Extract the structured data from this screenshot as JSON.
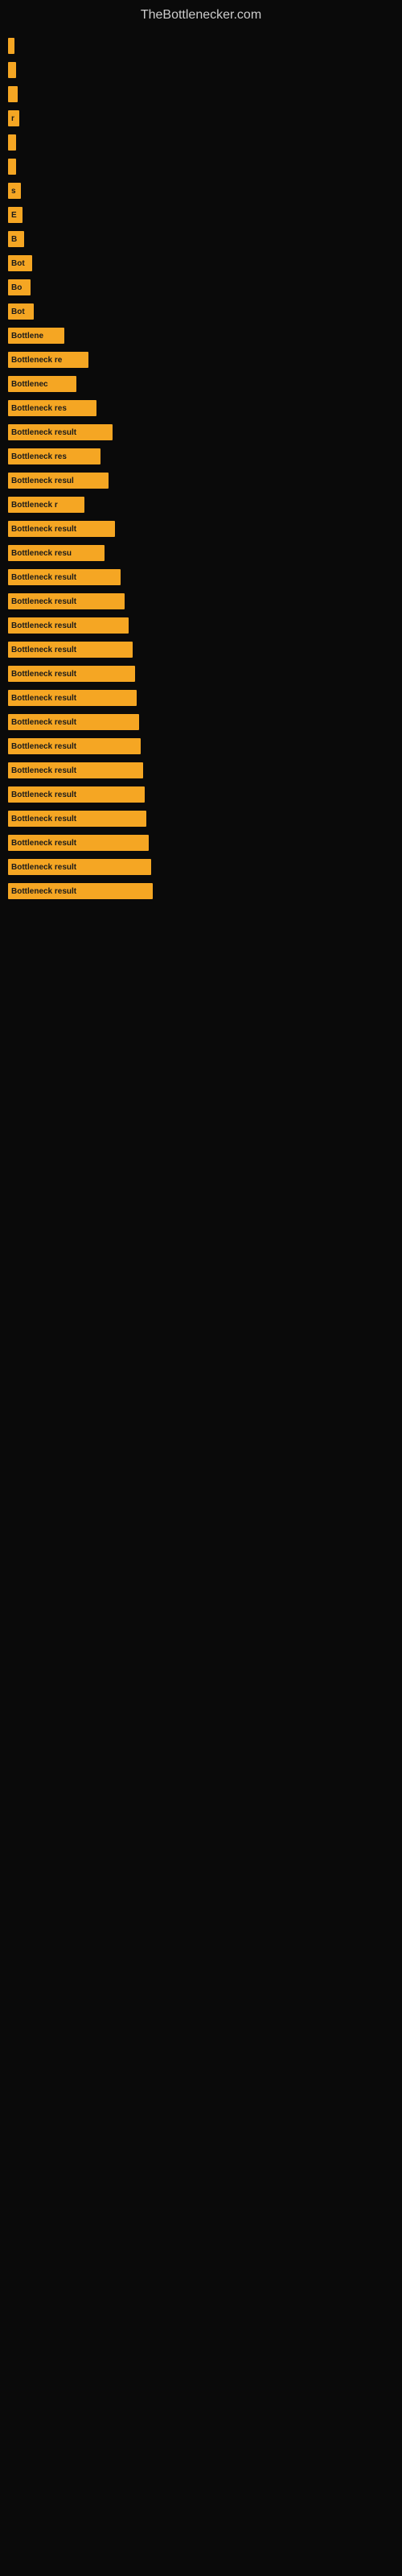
{
  "site": {
    "title": "TheBottlenecker.com"
  },
  "bars": [
    {
      "label": "",
      "width": 8
    },
    {
      "label": "",
      "width": 10
    },
    {
      "label": "",
      "width": 12
    },
    {
      "label": "r",
      "width": 14
    },
    {
      "label": "",
      "width": 10
    },
    {
      "label": "",
      "width": 10
    },
    {
      "label": "s",
      "width": 16
    },
    {
      "label": "E",
      "width": 18
    },
    {
      "label": "B",
      "width": 20
    },
    {
      "label": "Bot",
      "width": 30
    },
    {
      "label": "Bo",
      "width": 28
    },
    {
      "label": "Bot",
      "width": 32
    },
    {
      "label": "Bottlene",
      "width": 70
    },
    {
      "label": "Bottleneck re",
      "width": 100
    },
    {
      "label": "Bottlenec",
      "width": 85
    },
    {
      "label": "Bottleneck res",
      "width": 110
    },
    {
      "label": "Bottleneck result",
      "width": 130
    },
    {
      "label": "Bottleneck res",
      "width": 115
    },
    {
      "label": "Bottleneck resul",
      "width": 125
    },
    {
      "label": "Bottleneck r",
      "width": 95
    },
    {
      "label": "Bottleneck result",
      "width": 133
    },
    {
      "label": "Bottleneck resu",
      "width": 120
    },
    {
      "label": "Bottleneck result",
      "width": 140
    },
    {
      "label": "Bottleneck result",
      "width": 145
    },
    {
      "label": "Bottleneck result",
      "width": 150
    },
    {
      "label": "Bottleneck result",
      "width": 155
    },
    {
      "label": "Bottleneck result",
      "width": 158
    },
    {
      "label": "Bottleneck result",
      "width": 160
    },
    {
      "label": "Bottleneck result",
      "width": 163
    },
    {
      "label": "Bottleneck result",
      "width": 165
    },
    {
      "label": "Bottleneck result",
      "width": 168
    },
    {
      "label": "Bottleneck result",
      "width": 170
    },
    {
      "label": "Bottleneck result",
      "width": 172
    },
    {
      "label": "Bottleneck result",
      "width": 175
    },
    {
      "label": "Bottleneck result",
      "width": 178
    },
    {
      "label": "Bottleneck result",
      "width": 180
    }
  ]
}
